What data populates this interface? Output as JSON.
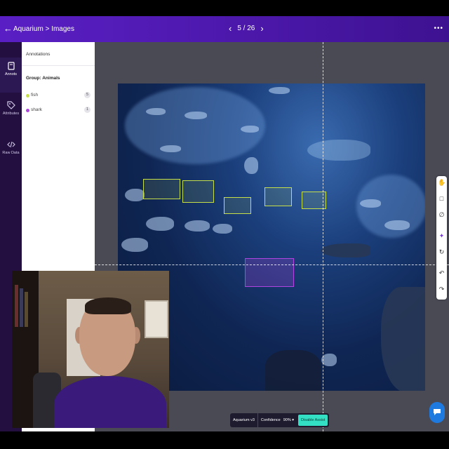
{
  "header": {
    "title": "Aquarium > Images",
    "pager": "5 / 26",
    "back_icon": "arrow-left-icon",
    "menu": "•••"
  },
  "rail": {
    "items": [
      {
        "label": "Annots",
        "icon": "annotations-icon",
        "active": true
      },
      {
        "label": "Attributes",
        "icon": "tag-icon",
        "active": false
      },
      {
        "label": "Raw Data",
        "icon": "code-icon",
        "active": false
      }
    ]
  },
  "panel": {
    "header": "Annotations",
    "group_title": "Group: Animals",
    "classes": [
      {
        "name": "fish",
        "count": "5",
        "color": "#c7e04a"
      },
      {
        "name": "shark",
        "count": "1",
        "color": "#b044e0"
      }
    ]
  },
  "bottom_bar": {
    "model": "Aquarium v3",
    "confidence_label": "Confidence",
    "confidence_value": "90%",
    "assist_button": "Disable Assist"
  },
  "toolbar": {
    "tools": [
      "hand-icon",
      "box-tool-icon",
      "polygon-tool-icon",
      "smart-select-icon",
      "repeat-icon",
      "undo-icon",
      "redo-icon"
    ]
  },
  "chat_icon": "chat-icon",
  "colors": {
    "header_bg": "#5a1fc4",
    "fish_box": "#c7e04a",
    "shark_box": "#b044e0",
    "assist_accent": "#33e0c4"
  }
}
